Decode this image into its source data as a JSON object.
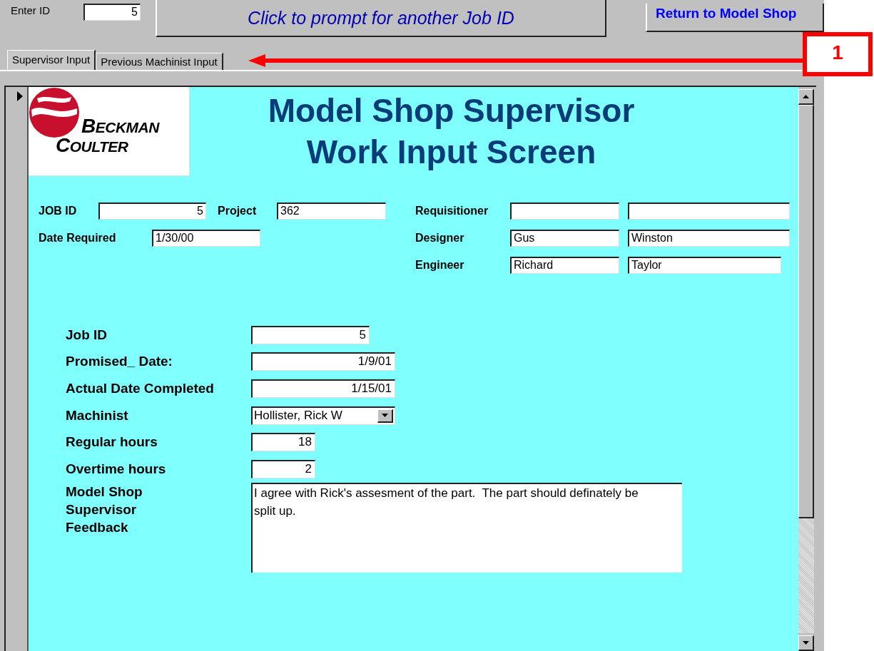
{
  "header": {
    "enter_id_label": "Enter ID",
    "enter_id_value": "5",
    "prompt_button": "Click to prompt for another Job ID",
    "return_button": "Return to Model Shop"
  },
  "tabs": [
    {
      "label": "Supervisor Input",
      "selected": true
    },
    {
      "label": "Previous Machinist Input",
      "selected": false
    }
  ],
  "callout": {
    "label": "1"
  },
  "logo": {
    "lines": [
      "BECKMAN",
      "COULTER"
    ]
  },
  "title": [
    "Model Shop Supervisor",
    "Work Input Screen"
  ],
  "job": {
    "job_id_label": "JOB ID",
    "job_id": "5",
    "project_label": "Project",
    "project": "362",
    "date_required_label": "Date Required",
    "date_required": "1/30/00"
  },
  "people": [
    {
      "label": "Requisitioner"
    },
    {
      "label": "Designer",
      "first": "Gus",
      "last": "Winston"
    },
    {
      "label": "Engineer",
      "first": "Richard",
      "last": "Taylor"
    }
  ],
  "work_fields": [
    {
      "kind": "id",
      "label": "Job ID",
      "value": "5"
    },
    {
      "kind": "date",
      "label": "Promised_ Date:",
      "value": "1/9/01"
    },
    {
      "kind": "date",
      "label": "Actual Date Completed",
      "value": "1/15/01"
    },
    {
      "kind": "combo",
      "label": "Machinist",
      "value": "Hollister, Rick W"
    },
    {
      "kind": "hours",
      "label": "Regular hours",
      "value": "18"
    },
    {
      "kind": "hours",
      "label": "Overtime hours",
      "value": "2"
    },
    {
      "kind": "memo",
      "label": "Model Shop Supervisor Feedback",
      "value": "I agree with Rick's assesment of the part.  The part should definately be split up."
    }
  ]
}
